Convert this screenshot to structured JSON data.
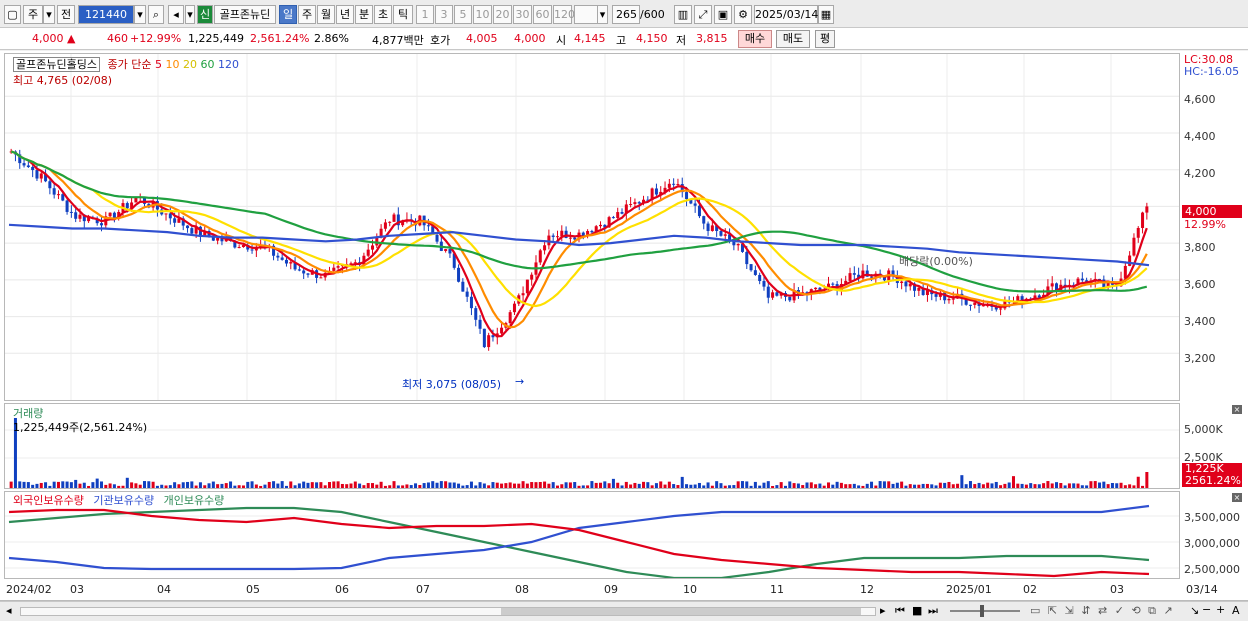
{
  "toolbar": {
    "market": "주",
    "period_prefix": "전",
    "code": "121440",
    "type_badge": "신",
    "stock_name": "골프존뉴딘",
    "periods": [
      "일",
      "주",
      "월",
      "년",
      "분",
      "초",
      "틱"
    ],
    "intervals": [
      "1",
      "3",
      "5",
      "10",
      "20",
      "30",
      "60",
      "120"
    ],
    "count": "265",
    "count_max": "/600",
    "date": "2025/03/14"
  },
  "quote": {
    "price": "4,000",
    "change": "460",
    "change_pct": "+12.99%",
    "volume": "1,225,449",
    "vol_ratio": "2,561.24%",
    "turnover": "2.86%",
    "amount": "4,877백만",
    "bid_label": "호가",
    "bid": "4,005",
    "ask": "4,000",
    "open_label": "시",
    "open": "4,145",
    "high_label": "고",
    "high": "4,150",
    "low_label": "저",
    "low": "3,815",
    "buy_button": "매수",
    "sell_button": "매도",
    "eval_button": "평"
  },
  "price_panel": {
    "stock_label": "골프존뉴딘홀딩스",
    "ma_label": "종가 단순",
    "ma_periods": [
      "5",
      "10",
      "20",
      "60",
      "120"
    ],
    "ma_colors": [
      "#e0001a",
      "#ff8c00",
      "#ffe000",
      "#20a040",
      "#3050d0"
    ],
    "high_label": "최고 4,765 (02/08)",
    "low_label": "최저 3,075 (08/05)",
    "dividend_label": "배당락(0.00%)",
    "lc": "LC:30.08",
    "hc": "HC:-16.05",
    "y_ticks": [
      "4,600",
      "4,400",
      "4,200",
      "4,000",
      "3,800",
      "3,600",
      "3,400",
      "3,200"
    ],
    "current_price": "4,000",
    "current_pct": "12.99%"
  },
  "volume_panel": {
    "title": "거래량",
    "value_label": "1,225,449주(2,561.24%)",
    "y_ticks": [
      "5,000K",
      "2,500K"
    ],
    "current": "1,225K",
    "current_pct": "2561.24%"
  },
  "holding_panel": {
    "legend": [
      "외국인보유수량",
      "기관보유수량",
      "개인보유수량"
    ],
    "colors": [
      "#e0001a",
      "#3050d0",
      "#2e8b57"
    ],
    "y_ticks": [
      "3,500,000",
      "3,000,000",
      "2,500,000"
    ]
  },
  "x_labels": [
    "2024/02",
    "03",
    "04",
    "05",
    "06",
    "07",
    "08",
    "09",
    "10",
    "11",
    "12",
    "2025/01",
    "02",
    "03",
    "03/14"
  ],
  "chart_data": {
    "type": "line",
    "title": "골프존뉴딘홀딩스",
    "series": [
      {
        "name": "종가",
        "values": [
          4300,
          4150,
          3950,
          3920,
          4050,
          3950,
          3850,
          3800,
          3780,
          3660,
          3620,
          3700,
          3930,
          3920,
          3700,
          3250,
          3460,
          3850,
          3850,
          3930,
          4040,
          4150,
          3900,
          3780,
          3500,
          3520,
          3560,
          3640,
          3620,
          3520,
          3500,
          3460,
          3490,
          3560,
          3600,
          3550,
          4000
        ]
      },
      {
        "name": "120",
        "values": [
          3900,
          3890,
          3880,
          3880,
          3870,
          3860,
          3840,
          3830,
          3830,
          3820,
          3810,
          3820,
          3840,
          3850,
          3860,
          3840,
          3820,
          3810,
          3790,
          3800,
          3820,
          3840,
          3830,
          3810,
          3800,
          3790,
          3790,
          3790,
          3780,
          3770,
          3750,
          3740,
          3730,
          3720,
          3710,
          3700,
          3680
        ]
      }
    ],
    "ylim": [
      3000,
      4765
    ]
  }
}
